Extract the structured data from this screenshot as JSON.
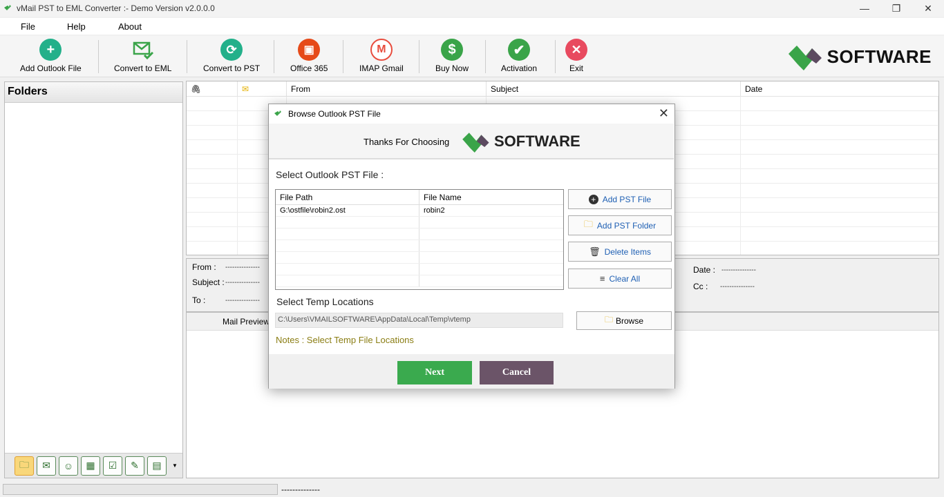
{
  "window": {
    "title": "vMail PST to EML Converter :- Demo Version v2.0.0.0",
    "minimize": "—",
    "restore": "❐",
    "close": "✕"
  },
  "menu": [
    "File",
    "Help",
    "About"
  ],
  "toolbar": {
    "items": [
      {
        "label": "Add Outlook File",
        "icon": "add-icon",
        "color": "#23b08a"
      },
      {
        "label": "Convert to EML",
        "icon": "email-check-icon",
        "color": "#3aa449"
      },
      {
        "label": "Convert to PST",
        "icon": "refresh-icon",
        "color": "#23b08a"
      },
      {
        "label": "Office 365",
        "icon": "office-icon",
        "color": "#e64a19"
      },
      {
        "label": "IMAP Gmail",
        "icon": "gmail-icon",
        "color": "#e84c3d"
      },
      {
        "label": "Buy Now",
        "icon": "dollar-icon",
        "color": "#3aa449"
      },
      {
        "label": "Activation",
        "icon": "check-icon",
        "color": "#3aa449"
      },
      {
        "label": "Exit",
        "icon": "close-icon",
        "color": "#e84a5f"
      }
    ],
    "brand": "SOFTWARE"
  },
  "folders": {
    "title": "Folders"
  },
  "mailgrid": {
    "columns": [
      "",
      "",
      "From",
      "Subject",
      "Date"
    ]
  },
  "mailinfo": {
    "from_label": "From :",
    "subject_label": "Subject :",
    "to_label": "To :",
    "date_label": "Date :",
    "cc_label": "Cc :",
    "placeholder": "---------------"
  },
  "preview": {
    "tab_label": "Mail Preview"
  },
  "status": {
    "text": "--------------"
  },
  "dialog": {
    "title": "Browse Outlook PST File",
    "thanks": "Thanks For Choosing",
    "brand": "SOFTWARE",
    "select_pst_label": "Select Outlook PST File :",
    "table": {
      "headers": [
        "File Path",
        "File Name"
      ],
      "rows": [
        {
          "path": "G:\\ostfile\\robin2.ost",
          "name": "robin2"
        }
      ]
    },
    "buttons": {
      "add_file": "Add PST File",
      "add_folder": "Add PST Folder",
      "delete": "Delete Items",
      "clear": "Clear All",
      "browse": "Browse",
      "next": "Next",
      "cancel": "Cancel"
    },
    "temp_label": "Select Temp Locations",
    "temp_path": "C:\\Users\\VMAILSOFTWARE\\AppData\\Local\\Temp\\vtemp",
    "notes": "Notes :  Select Temp File Locations"
  }
}
